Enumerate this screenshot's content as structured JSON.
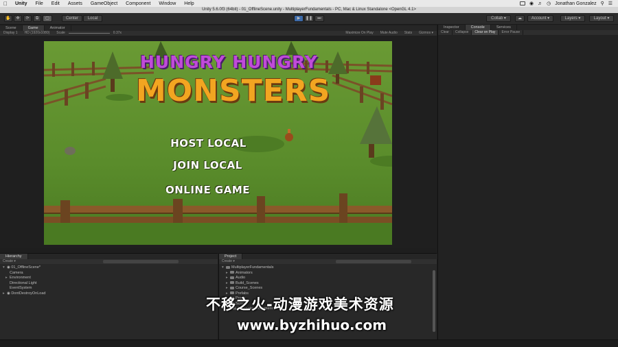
{
  "menubar": {
    "app_name": "Unity",
    "items": [
      "File",
      "Edit",
      "Assets",
      "GameObject",
      "Component",
      "Window",
      "Help"
    ],
    "user": "Jonathan Gonzalez"
  },
  "window": {
    "title": "Unity 5.6.0f3 (64bit) - 01_OfflineScene.unity - MultiplayerFundamentals - PC, Mac & Linux Standalone <OpenGL 4.1>"
  },
  "toolbar": {
    "pivot_label": "Center",
    "space_label": "Local",
    "collab_label": "Collab ▾",
    "account_label": "Account ▾",
    "layers_label": "Layers ▾",
    "layout_label": "Layout ▾"
  },
  "scene_tabs": [
    "Scene",
    "Game",
    "Animator"
  ],
  "game_toolbar": {
    "display": "Display 1",
    "resolution": "HD (1920x1080)",
    "scale_label": "Scale",
    "scale_value": "0.37x",
    "options": [
      "Maximize On Play",
      "Mute Audio",
      "Stats",
      "Gizmos ▾"
    ]
  },
  "game": {
    "logo_line1": "HUNGRY HUNGRY",
    "logo_line2": "MONSTERS",
    "buttons": [
      "HOST LOCAL",
      "JOIN LOCAL",
      "ONLINE GAME"
    ]
  },
  "right_tabs": [
    "Inspector",
    "Console",
    "Services"
  ],
  "console_bar": [
    "Clear",
    "Collapse",
    "Clear on Play",
    "Error Pause"
  ],
  "hierarchy": {
    "tab": "Hierarchy",
    "create": "Create ▾",
    "items": [
      {
        "label": "01_OfflineScene*",
        "depth": 0
      },
      {
        "label": "Camera",
        "depth": 1
      },
      {
        "label": "Environment",
        "depth": 1
      },
      {
        "label": "Directional Light",
        "depth": 1
      },
      {
        "label": "EventSystem",
        "depth": 1
      },
      {
        "label": "DontDestroyOnLoad",
        "depth": 0
      }
    ]
  },
  "project": {
    "tab": "Project",
    "create": "Create ▾",
    "items": [
      {
        "label": "MultiplayerFundamentals",
        "depth": 0
      },
      {
        "label": "Animators",
        "depth": 1
      },
      {
        "label": "Audio",
        "depth": 1
      },
      {
        "label": "Build_Scenes",
        "depth": 1
      },
      {
        "label": "Course_Scenes",
        "depth": 1
      },
      {
        "label": "Prefabs",
        "depth": 1
      },
      {
        "label": "Props",
        "depth": 1
      },
      {
        "label": "Scripts",
        "depth": 1
      },
      {
        "label": "Character Movement",
        "depth": 2
      }
    ]
  },
  "watermark": {
    "line1": "不移之火-动漫游戏美术资源",
    "line2": "www.byzhihuo.com"
  },
  "colors": {
    "grass": "#5f8f2e",
    "logo_purple": "#c04bd8",
    "logo_orange": "#f2a521",
    "play_blue": "#3d6aa8"
  }
}
